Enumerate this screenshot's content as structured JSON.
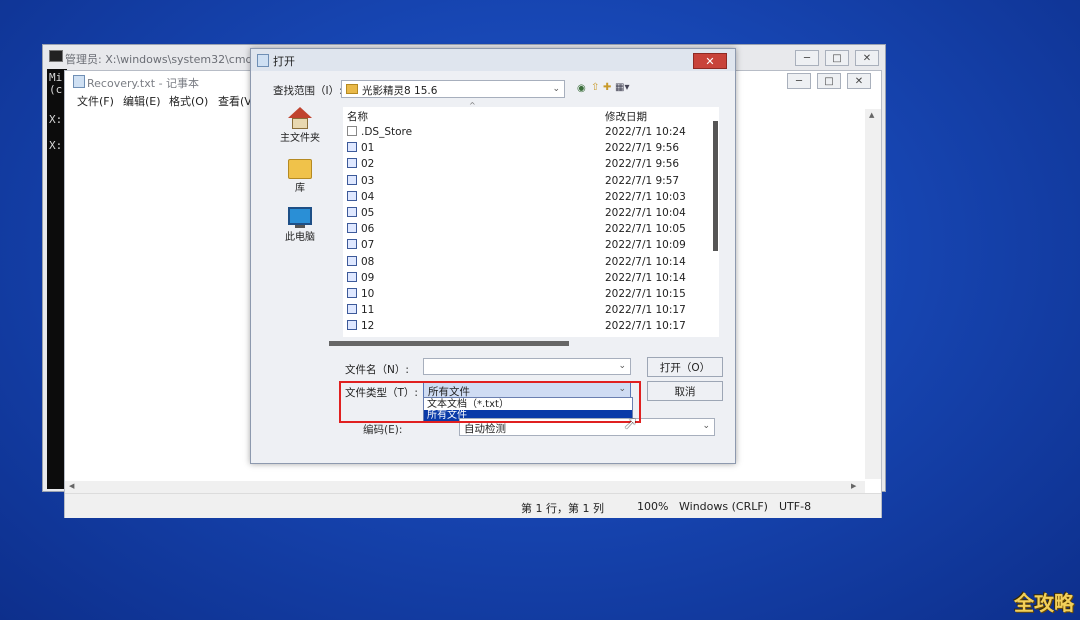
{
  "cmd": {
    "title": "管理员: X:\\windows\\system32\\cmd.exe",
    "lines": [
      "Mi",
      "(c",
      "X:",
      "X:"
    ]
  },
  "notepad": {
    "title": "Recovery.txt - 记事本",
    "menus": [
      "文件(F)",
      "编辑(E)",
      "格式(O)",
      "查看(V"
    ],
    "status": {
      "position": "第 1 行，第 1 列",
      "zoom": "100%",
      "line_ending": "Windows (CRLF)",
      "encoding": "UTF-8"
    }
  },
  "dialog": {
    "title": "打开",
    "lookin_label": "查找范围（I）:",
    "lookin_value": "光影精灵8 15.6",
    "places": [
      "主文件夹",
      "库",
      "此电脑"
    ],
    "columns": {
      "name": "名称",
      "date": "修改日期"
    },
    "files": [
      {
        "name": ".DS_Store",
        "date": "2022/7/1 10:24",
        "icon": "document-icon"
      },
      {
        "name": "01",
        "date": "2022/7/1 9:56",
        "icon": "image-file-icon"
      },
      {
        "name": "02",
        "date": "2022/7/1 9:56",
        "icon": "image-file-icon"
      },
      {
        "name": "03",
        "date": "2022/7/1 9:57",
        "icon": "image-file-icon"
      },
      {
        "name": "04",
        "date": "2022/7/1 10:03",
        "icon": "image-file-icon"
      },
      {
        "name": "05",
        "date": "2022/7/1 10:04",
        "icon": "image-file-icon"
      },
      {
        "name": "06",
        "date": "2022/7/1 10:05",
        "icon": "image-file-icon"
      },
      {
        "name": "07",
        "date": "2022/7/1 10:09",
        "icon": "image-file-icon"
      },
      {
        "name": "08",
        "date": "2022/7/1 10:14",
        "icon": "image-file-icon"
      },
      {
        "name": "09",
        "date": "2022/7/1 10:14",
        "icon": "image-file-icon"
      },
      {
        "name": "10",
        "date": "2022/7/1 10:15",
        "icon": "image-file-icon"
      },
      {
        "name": "11",
        "date": "2022/7/1 10:17",
        "icon": "image-file-icon"
      },
      {
        "name": "12",
        "date": "2022/7/1 10:17",
        "icon": "image-file-icon"
      }
    ],
    "filename_label": "文件名（N）:",
    "filename_value": "",
    "open_button": "打开（O）",
    "filetype_label": "文件类型（T）:",
    "filetype_value": "所有文件",
    "filetype_options": [
      "文本文档（*.txt）",
      "所有文件"
    ],
    "selected_option_index": 1,
    "cancel_button": "取消",
    "encoding_label": "编码(E):",
    "encoding_value": "自动检测"
  },
  "watermark": "全攻略",
  "colors": {
    "highlight_box": "#e02020",
    "selected_option": "#0a3aa8",
    "desktop": "#1746b3"
  }
}
